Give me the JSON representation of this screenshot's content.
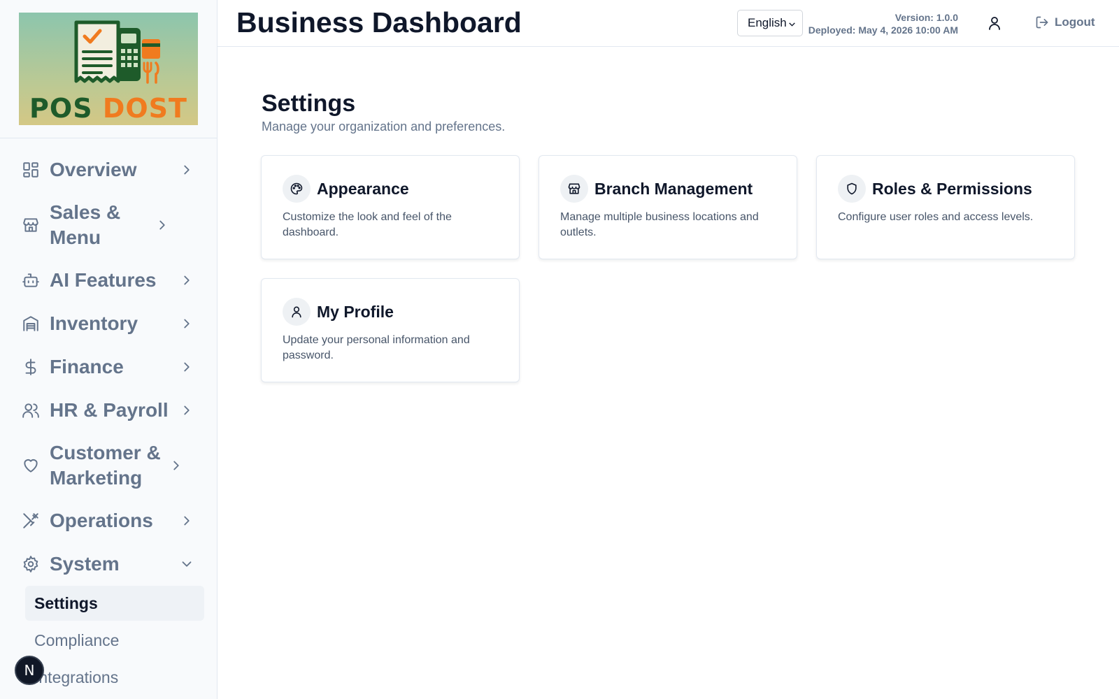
{
  "sidebar": {
    "logo": {
      "word1": "POS",
      "word2": "DOST"
    },
    "nav": [
      {
        "name": "overview",
        "label": "Overview",
        "icon": "grid-icon",
        "state": "collapsed"
      },
      {
        "name": "sales-menu",
        "label": "Sales & Menu",
        "icon": "store-icon",
        "state": "collapsed"
      },
      {
        "name": "ai-features",
        "label": "AI Features",
        "icon": "bot-icon",
        "state": "collapsed"
      },
      {
        "name": "inventory",
        "label": "Inventory",
        "icon": "warehouse-icon",
        "state": "collapsed"
      },
      {
        "name": "finance",
        "label": "Finance",
        "icon": "dollar-icon",
        "state": "collapsed"
      },
      {
        "name": "hr-payroll",
        "label": "HR & Payroll",
        "icon": "users-icon",
        "state": "collapsed"
      },
      {
        "name": "customer-marketing",
        "label": "Customer & Marketing",
        "icon": "heart-icon",
        "state": "collapsed"
      },
      {
        "name": "operations",
        "label": "Operations",
        "icon": "utensils-crossed-icon",
        "state": "collapsed"
      },
      {
        "name": "system",
        "label": "System",
        "icon": "gear-icon",
        "state": "expanded"
      }
    ],
    "system_children": [
      {
        "label": "Settings",
        "active": true
      },
      {
        "label": "Compliance",
        "active": false
      },
      {
        "label": "Integrations",
        "active": false
      }
    ],
    "badge": "N"
  },
  "header": {
    "title": "Business Dashboard",
    "language": "English",
    "version": "Version: 1.0.0",
    "deployed": "Deployed: May 4, 2026 10:00 AM",
    "logout_label": "Logout"
  },
  "main": {
    "title": "Settings",
    "subtitle": "Manage your organization and preferences.",
    "cards": [
      {
        "title": "Appearance",
        "desc": "Customize the look and feel of the dashboard.",
        "icon": "palette-icon"
      },
      {
        "title": "Branch Management",
        "desc": "Manage multiple business locations and outlets.",
        "icon": "store-icon"
      },
      {
        "title": "Roles & Permissions",
        "desc": "Configure user roles and access levels.",
        "icon": "shield-icon"
      },
      {
        "title": "My Profile",
        "desc": "Update your personal information and password.",
        "icon": "user-icon"
      }
    ]
  },
  "colors": {
    "sidebar_bg": "#f8fafc",
    "nav_text": "#64748b",
    "heading": "#0f172a",
    "active_bg": "#eef2f6",
    "logo_green": "#1e5b2a",
    "logo_orange": "#f07b1f"
  }
}
